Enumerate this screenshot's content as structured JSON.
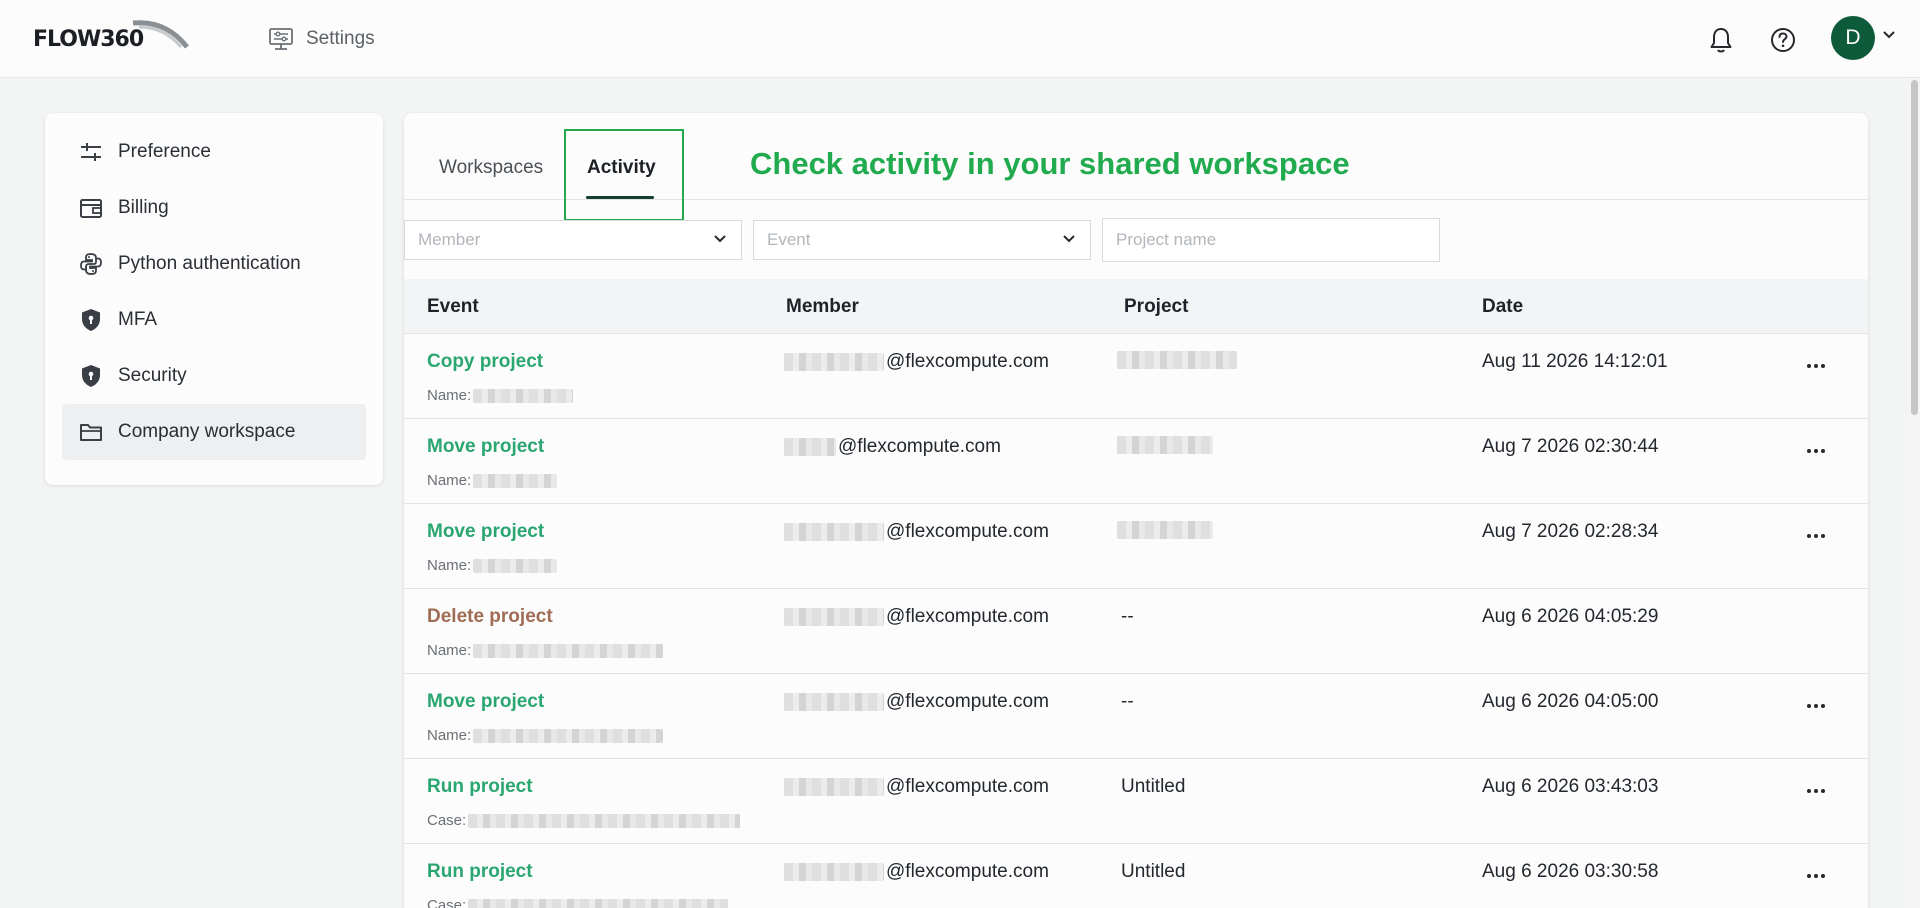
{
  "app": {
    "logo_text": "FLOW360",
    "nav_settings_label": "Settings",
    "avatar_initial": "D"
  },
  "sidebar": {
    "items": [
      {
        "label": "Preference",
        "icon": "sliders-icon"
      },
      {
        "label": "Billing",
        "icon": "wallet-icon"
      },
      {
        "label": "Python authentication",
        "icon": "python-icon"
      },
      {
        "label": "MFA",
        "icon": "shield-lock-icon"
      },
      {
        "label": "Security",
        "icon": "shield-lock-icon"
      },
      {
        "label": "Company workspace",
        "icon": "folder-icon",
        "active": true
      }
    ]
  },
  "tabs": [
    {
      "label": "Workspaces"
    },
    {
      "label": "Activity",
      "active": true
    }
  ],
  "headline": "Check activity in your shared workspace",
  "filters": {
    "member_placeholder": "Member",
    "event_placeholder": "Event",
    "project_placeholder": "Project name"
  },
  "table": {
    "headers": {
      "event": "Event",
      "member": "Member",
      "project": "Project",
      "date": "Date"
    },
    "rows": [
      {
        "event": "Copy project",
        "type": "ok",
        "sub_label": "Name:",
        "member_domain": "@flexcompute.com",
        "project": "",
        "date": "Aug 11 2026 14:12:01",
        "has_menu": true
      },
      {
        "event": "Move project",
        "type": "ok",
        "sub_label": "Name:",
        "member_domain": "@flexcompute.com",
        "project": "",
        "date": "Aug 7 2026 02:30:44",
        "has_menu": true
      },
      {
        "event": "Move project",
        "type": "ok",
        "sub_label": "Name:",
        "member_domain": "@flexcompute.com",
        "project": "",
        "date": "Aug 7 2026 02:28:34",
        "has_menu": true
      },
      {
        "event": "Delete project",
        "type": "delete",
        "sub_label": "Name:",
        "member_domain": "@flexcompute.com",
        "project": "--",
        "date": "Aug 6 2026 04:05:29",
        "has_menu": false
      },
      {
        "event": "Move project",
        "type": "ok",
        "sub_label": "Name:",
        "member_domain": "@flexcompute.com",
        "project": "--",
        "date": "Aug 6 2026 04:05:00",
        "has_menu": true
      },
      {
        "event": "Run project",
        "type": "ok",
        "sub_label": "Case:",
        "member_domain": "@flexcompute.com",
        "project": "Untitled",
        "date": "Aug 6 2026 03:43:03",
        "has_menu": true
      },
      {
        "event": "Run project",
        "type": "ok",
        "sub_label": "Case:",
        "member_domain": "@flexcompute.com",
        "project": "Untitled",
        "date": "Aug 6 2026 03:30:58",
        "has_menu": true
      }
    ]
  },
  "colors": {
    "brand_green": "#0e5b3b",
    "event_green": "#2aa670",
    "event_delete": "#a06c55",
    "headline_green": "#21ab4e"
  }
}
